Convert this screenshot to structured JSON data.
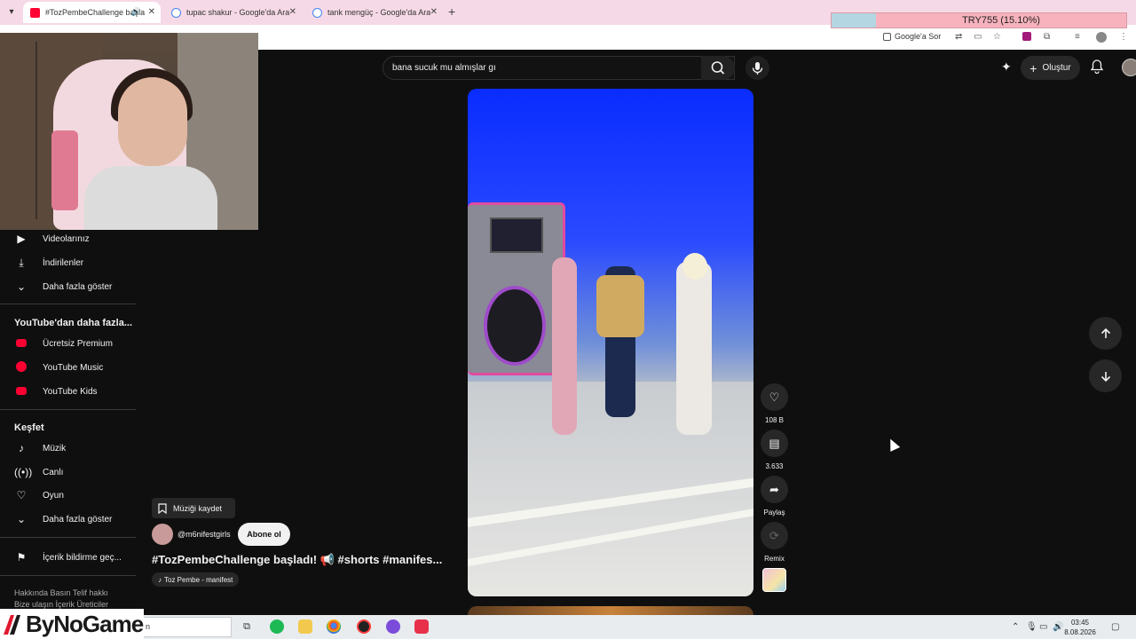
{
  "browser": {
    "tabs": [
      {
        "title": "#TozPembeChallenge başla",
        "active": true
      },
      {
        "title": "tupac shakur - Google'da Ara",
        "active": false
      },
      {
        "title": "tank mengüç - Google'da Ara",
        "active": false
      }
    ],
    "new_tab": "+",
    "google_sor": "Google'a Sor"
  },
  "ticker": {
    "text": "TRY755 (15.10%)",
    "progress": 0.151
  },
  "youtube": {
    "search_query": "bana sucuk mu almışlar gı",
    "create_label": "Oluştur"
  },
  "sidebar": {
    "items_top": [
      {
        "icon": "play-square-icon",
        "label": "Videolarınız"
      },
      {
        "icon": "download-icon",
        "label": "İndirilenler"
      },
      {
        "icon": "chevron-down-icon",
        "label": "Daha fazla göster"
      }
    ],
    "more_from_youtube": {
      "heading": "YouTube'dan daha fazla...",
      "items": [
        {
          "icon": "youtube-premium-icon",
          "label": "Ücretsiz Premium"
        },
        {
          "icon": "youtube-music-icon",
          "label": "YouTube Music"
        },
        {
          "icon": "youtube-kids-icon",
          "label": "YouTube Kids"
        }
      ]
    },
    "explore": {
      "heading": "Keşfet",
      "items": [
        {
          "icon": "music-note-icon",
          "label": "Müzik"
        },
        {
          "icon": "live-icon",
          "label": "Canlı"
        },
        {
          "icon": "gamepad-icon",
          "label": "Oyun"
        },
        {
          "icon": "chevron-down-icon",
          "label": "Daha fazla göster"
        }
      ]
    },
    "report": {
      "icon": "flag-icon",
      "label": "İçerik bildirme geç..."
    },
    "footer": {
      "line1": "Hakkında  Basın  Telif hakkı",
      "line2": "Bize ulaşın  İçerik Üreticiler"
    }
  },
  "short": {
    "save_music": "Müziği kaydet",
    "channel": "@m6nifestgirls",
    "subscribe": "Abone ol",
    "title": "#TozPembeChallenge başladı! 📢  #shorts #manifes...",
    "sound": "Toz Pembe - manifest",
    "actions": [
      {
        "icon": "like-icon",
        "label": "108 B"
      },
      {
        "icon": "comment-icon",
        "label": "3.633"
      },
      {
        "icon": "share-icon",
        "label": "Paylaş"
      },
      {
        "icon": "remix-icon",
        "label": "Remix"
      }
    ]
  },
  "taskbar": {
    "search_text": "n",
    "time": "03:45",
    "date": "8.08.2026"
  },
  "brand": {
    "text": "ByNoGame"
  },
  "colors": {
    "accent": "#ff0033",
    "background": "#0f0f0f",
    "tabstrip": "#f6d9e6"
  }
}
